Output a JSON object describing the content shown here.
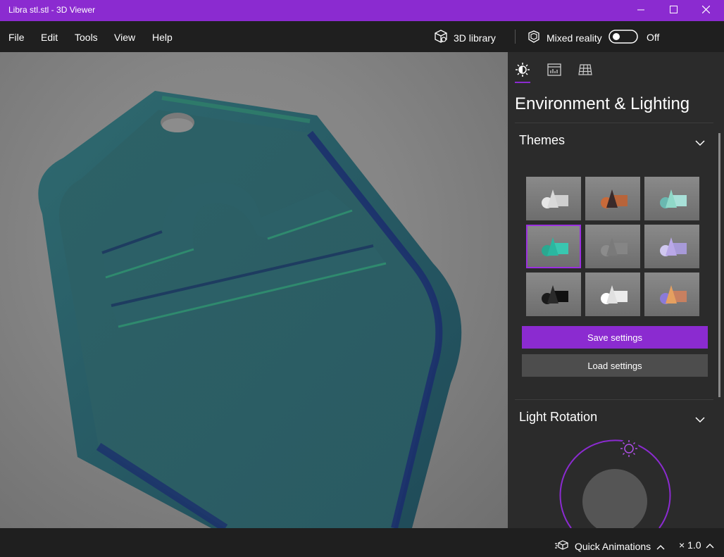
{
  "window": {
    "title": "Libra stl.stl - 3D Viewer",
    "controls": [
      "minimize-icon",
      "maximize-icon",
      "close-icon"
    ]
  },
  "menu": {
    "items": [
      "File",
      "Edit",
      "Tools",
      "View",
      "Help"
    ]
  },
  "toolbar": {
    "library_label": "3D library",
    "mixed_reality_label": "Mixed reality",
    "toggle_state": "Off"
  },
  "panel": {
    "tabs": [
      "environment-lighting-icon",
      "stats-icon",
      "grid-icon"
    ],
    "heading": "Environment & Lighting",
    "themes": {
      "title": "Themes",
      "selected_index": 3,
      "swatches": [
        {
          "cone": "#d9d9d9",
          "sphere": "#e6e6e6",
          "cube": "#cfcfcf"
        },
        {
          "cone": "#3a2a2a",
          "sphere": "#c86a3a",
          "cube": "#b8643a"
        },
        {
          "cone": "#8fd8c8",
          "sphere": "#6ab8b0",
          "cube": "#a8e0d8"
        },
        {
          "cone": "#2bb7a0",
          "sphere": "#2aa890",
          "cube": "#39c7b0"
        },
        {
          "cone": "#7a7a7a",
          "sphere": "#8c8c8c",
          "cube": "#858585"
        },
        {
          "cone": "#b9a8e8",
          "sphere": "#d0c8f0",
          "cube": "#a79ad8"
        },
        {
          "cone": "#2a2a2a",
          "sphere": "#1a1a1a",
          "cube": "#101010"
        },
        {
          "cone": "#e0e0e0",
          "sphere": "#ffffff",
          "cube": "#ebebeb"
        },
        {
          "cone": "#e5a060",
          "sphere": "#8b7ad8",
          "cube": "#c88060"
        }
      ]
    },
    "save_label": "Save settings",
    "load_label": "Load settings",
    "light_rotation": {
      "title": "Light Rotation"
    }
  },
  "status": {
    "animations_label": "Quick Animations",
    "speed_label": "× 1.0"
  },
  "colors": {
    "accent": "#8b2bd0",
    "model": "#2a5c63",
    "background": "#858585"
  }
}
